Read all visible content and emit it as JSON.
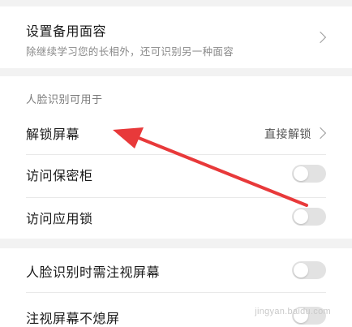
{
  "backup_face": {
    "title": "设置备用面容",
    "subtitle": "除继续学习您的长相外，还可识别另一种面容"
  },
  "usage_section": {
    "label": "人脸识别可用于",
    "unlock_screen": {
      "title": "解锁屏幕",
      "value": "直接解锁"
    },
    "access_safe": {
      "title": "访问保密柜",
      "enabled": false
    },
    "access_app_lock": {
      "title": "访问应用锁",
      "enabled": false
    }
  },
  "attention_section": {
    "require_gaze": {
      "title": "人脸识别时需注视屏幕",
      "enabled": false
    },
    "gaze_no_sleep": {
      "title": "注视屏幕不熄屏",
      "enabled": false
    }
  },
  "annotation": {
    "arrow_color": "#e8393a"
  },
  "watermark": {
    "text": "jingyan.baidu.com"
  }
}
